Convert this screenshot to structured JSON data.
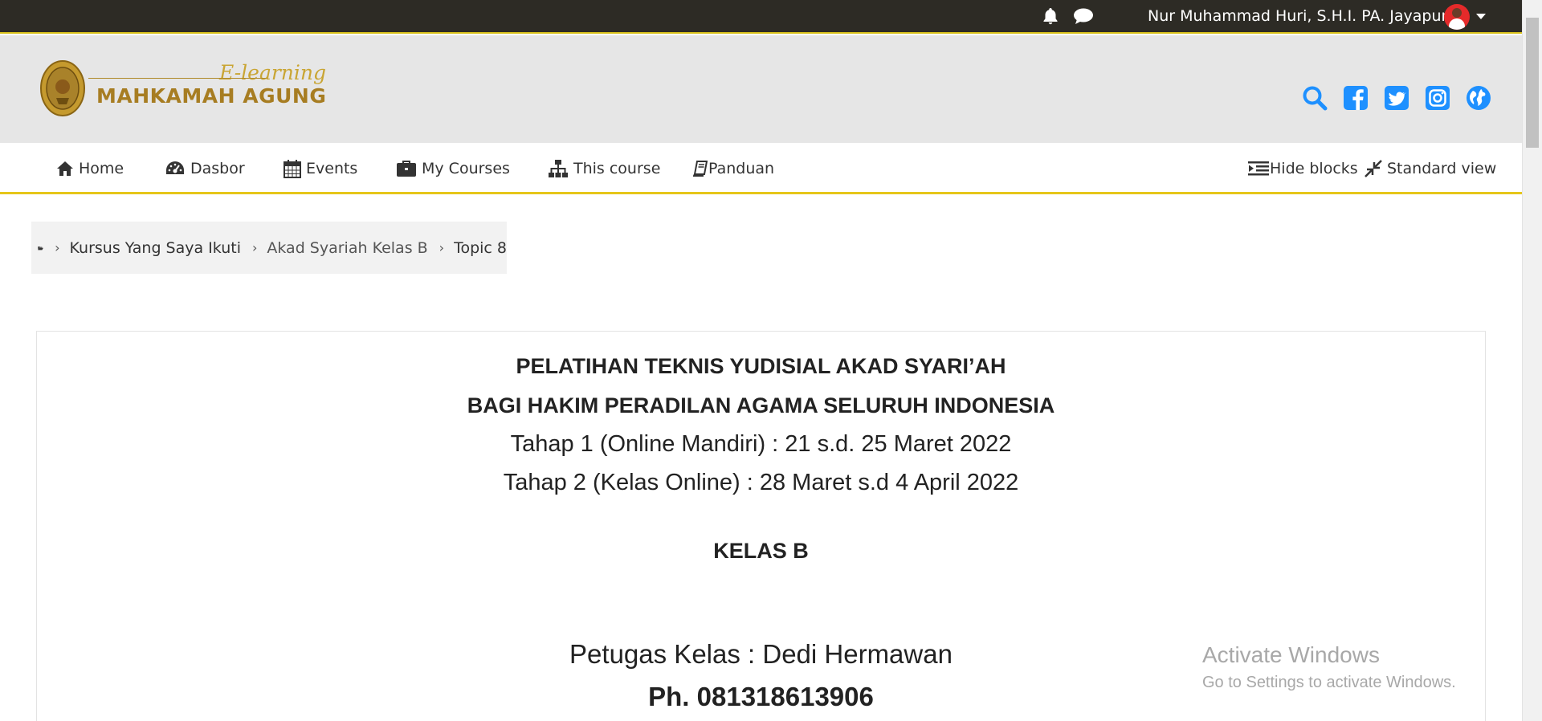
{
  "topbar": {
    "username": "Nur Muhammad Huri, S.H.I. PA. Jayapura"
  },
  "logo": {
    "elearning": "E-learning",
    "name": "MAHKAMAH AGUNG"
  },
  "colors": {
    "topbar": "#2d2b25",
    "accent": "#e6c619",
    "social_blue": "#1e90ff",
    "logo_gold": "#a77d22"
  },
  "nav": {
    "home": "Home",
    "dasbor": "Dasbor",
    "events": "Events",
    "my_courses": "My Courses",
    "this_course": "This course",
    "panduan": "Panduan",
    "hide_blocks": "Hide blocks",
    "standard_view": "Standard view"
  },
  "breadcrumb": {
    "items": [
      "Kursus Yang Saya Ikuti",
      "Akad Syariah Kelas B",
      "Topic 8"
    ]
  },
  "content": {
    "title_1": "PELATIHAN TEKNIS YUDISIAL AKAD SYARI’AH",
    "title_2": "BAGI HAKIM PERADILAN AGAMA SELURUH INDONESIA",
    "stage_1": "Tahap 1 (Online Mandiri) : 21 s.d. 25 Maret 2022",
    "stage_2": "Tahap 2 (Kelas Online) : 28 Maret s.d 4 April 2022",
    "class_name": "KELAS B",
    "officer": "Petugas Kelas : Dedi Hermawan",
    "phone": "Ph. 081318613906"
  },
  "watermark": {
    "line_1": "Activate Windows",
    "line_2": "Go to Settings to activate Windows."
  }
}
